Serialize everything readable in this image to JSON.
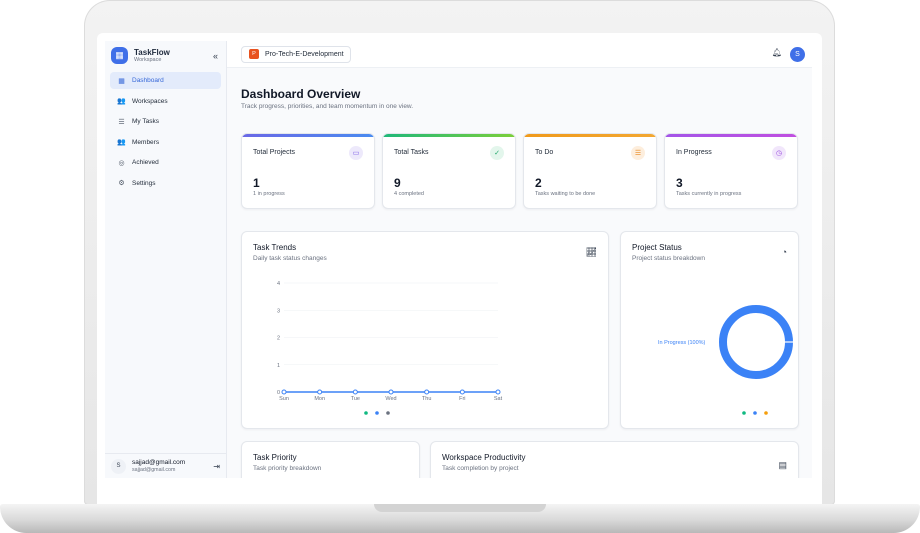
{
  "app": {
    "name": "TaskFlow",
    "subtitle": "Workspace",
    "collapse_icon": "«"
  },
  "sidebar": {
    "items": [
      {
        "label": "Dashboard",
        "icon": "grid-icon",
        "glyph": "▦",
        "active": true
      },
      {
        "label": "Workspaces",
        "icon": "people-icon",
        "glyph": "👥",
        "active": false
      },
      {
        "label": "My Tasks",
        "icon": "list-icon",
        "glyph": "☰",
        "active": false
      },
      {
        "label": "Members",
        "icon": "members-icon",
        "glyph": "👥",
        "active": false
      },
      {
        "label": "Achieved",
        "icon": "check-circle-icon",
        "glyph": "◎",
        "active": false
      },
      {
        "label": "Settings",
        "icon": "gear-icon",
        "glyph": "⚙",
        "active": false
      }
    ],
    "user": {
      "initial": "S",
      "name": "sajjad@gmail.com",
      "email": "sajjad@gmail.com"
    }
  },
  "topbar": {
    "workspace_badge": "P",
    "workspace_name": "Pro-Tech-E-Development",
    "user_initial": "S"
  },
  "header": {
    "title": "Dashboard Overview",
    "subtitle": "Track progress, priorities, and team momentum in one view."
  },
  "stats": [
    {
      "label": "Total Projects",
      "value": "1",
      "note": "1 in progress",
      "accent": "#6a68e6",
      "accent2": "#4a8bf0",
      "icon_bg": "#ede9fb",
      "icon_color": "#7c5ce6",
      "glyph": "▭"
    },
    {
      "label": "Total Tasks",
      "value": "9",
      "note": "4 completed",
      "accent": "#1fb87a",
      "accent2": "#7ccf3b",
      "icon_bg": "#e3f6ec",
      "icon_color": "#1fa56a",
      "glyph": "✓"
    },
    {
      "label": "To Do",
      "value": "2",
      "note": "Tasks waiting to be done",
      "accent": "#f09a1c",
      "accent2": "#f2a732",
      "icon_bg": "#fdeedd",
      "icon_color": "#e8861c",
      "glyph": "☰"
    },
    {
      "label": "In Progress",
      "value": "3",
      "note": "Tasks currently in progress",
      "accent": "#a455e8",
      "accent2": "#c04fe0",
      "icon_bg": "#f1e6fb",
      "icon_color": "#9a4ce0",
      "glyph": "◷"
    }
  ],
  "task_trends": {
    "title": "Task Trends",
    "subtitle": "Daily task status changes",
    "legend_colors": [
      "#10b981",
      "#3b82f6",
      "#6b7280"
    ]
  },
  "project_status": {
    "title": "Project Status",
    "subtitle": "Project status breakdown",
    "legend_colors": [
      "#10b981",
      "#3b82f6",
      "#f59e0b"
    ]
  },
  "task_priority": {
    "title": "Task Priority",
    "subtitle": "Task priority breakdown"
  },
  "workspace_productivity": {
    "title": "Workspace Productivity",
    "subtitle": "Task completion by project"
  },
  "chart_data": [
    {
      "type": "line",
      "categories": [
        "Sun",
        "Mon",
        "Tue",
        "Wed",
        "Thu",
        "Fri",
        "Sat"
      ],
      "series": [
        {
          "values": [
            0,
            0,
            0,
            0,
            0,
            0,
            0
          ],
          "color": "#3b82f6"
        }
      ],
      "ylim": [
        0,
        4
      ],
      "yticks": [
        "0",
        "1",
        "2",
        "3",
        "4"
      ],
      "grid": true
    },
    {
      "type": "pie",
      "slices": [
        {
          "label": "In Progress (100%)",
          "value": 100,
          "color": "#3b82f6"
        }
      ],
      "donut": true
    }
  ]
}
